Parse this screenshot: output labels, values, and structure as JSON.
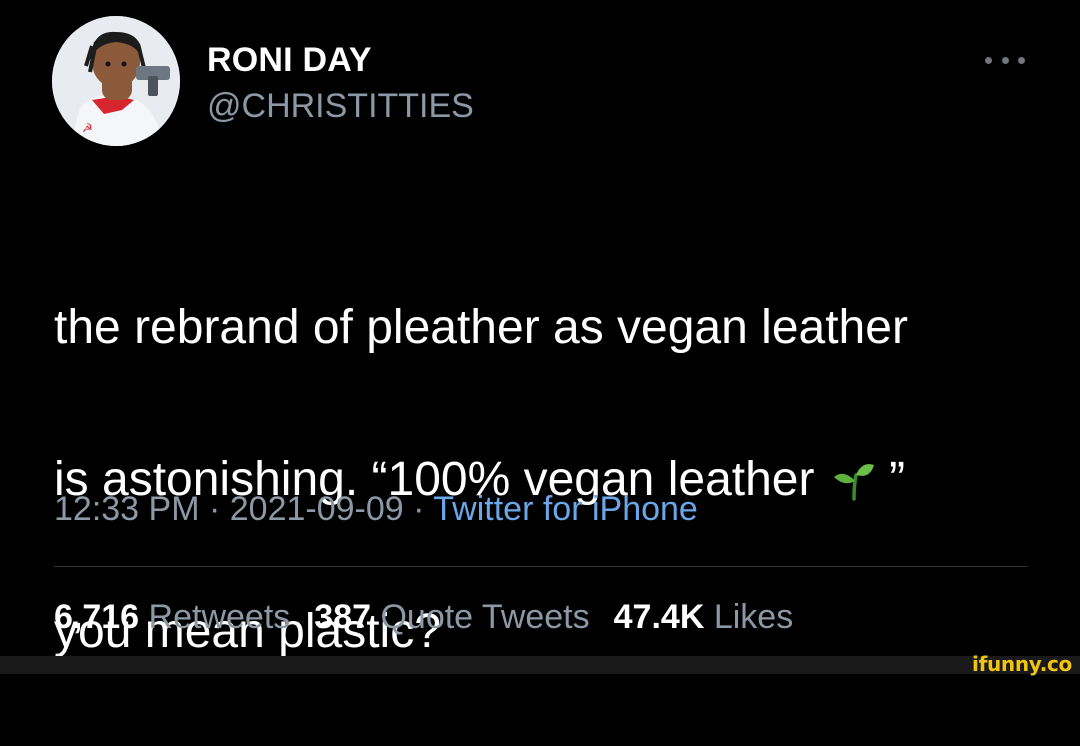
{
  "author": {
    "name": "RONI DAY",
    "handle": "@CHRISTITTIES"
  },
  "tweet": {
    "line1": "the rebrand of pleather as vegan leather",
    "line2_pre": "is astonishing. “100% vegan leather ",
    "line2_icon": "sprout-icon",
    "line2_post": " ”",
    "line3": "you mean plastic?"
  },
  "meta": {
    "time": "12:33 PM",
    "sep1": " · ",
    "date": "2021-09-09",
    "sep2": " · ",
    "source": "Twitter for iPhone"
  },
  "stats": {
    "retweets_count": "6,716",
    "retweets_label": "Retweets",
    "quotes_count": "387",
    "quotes_label": "Quote Tweets",
    "likes_count": "47.4K",
    "likes_label": "Likes"
  },
  "watermark": "ifunny.co",
  "colors": {
    "background": "#000000",
    "secondary_text": "#8b98a5",
    "link": "#6aa7e9",
    "watermark": "#f1c40f"
  }
}
